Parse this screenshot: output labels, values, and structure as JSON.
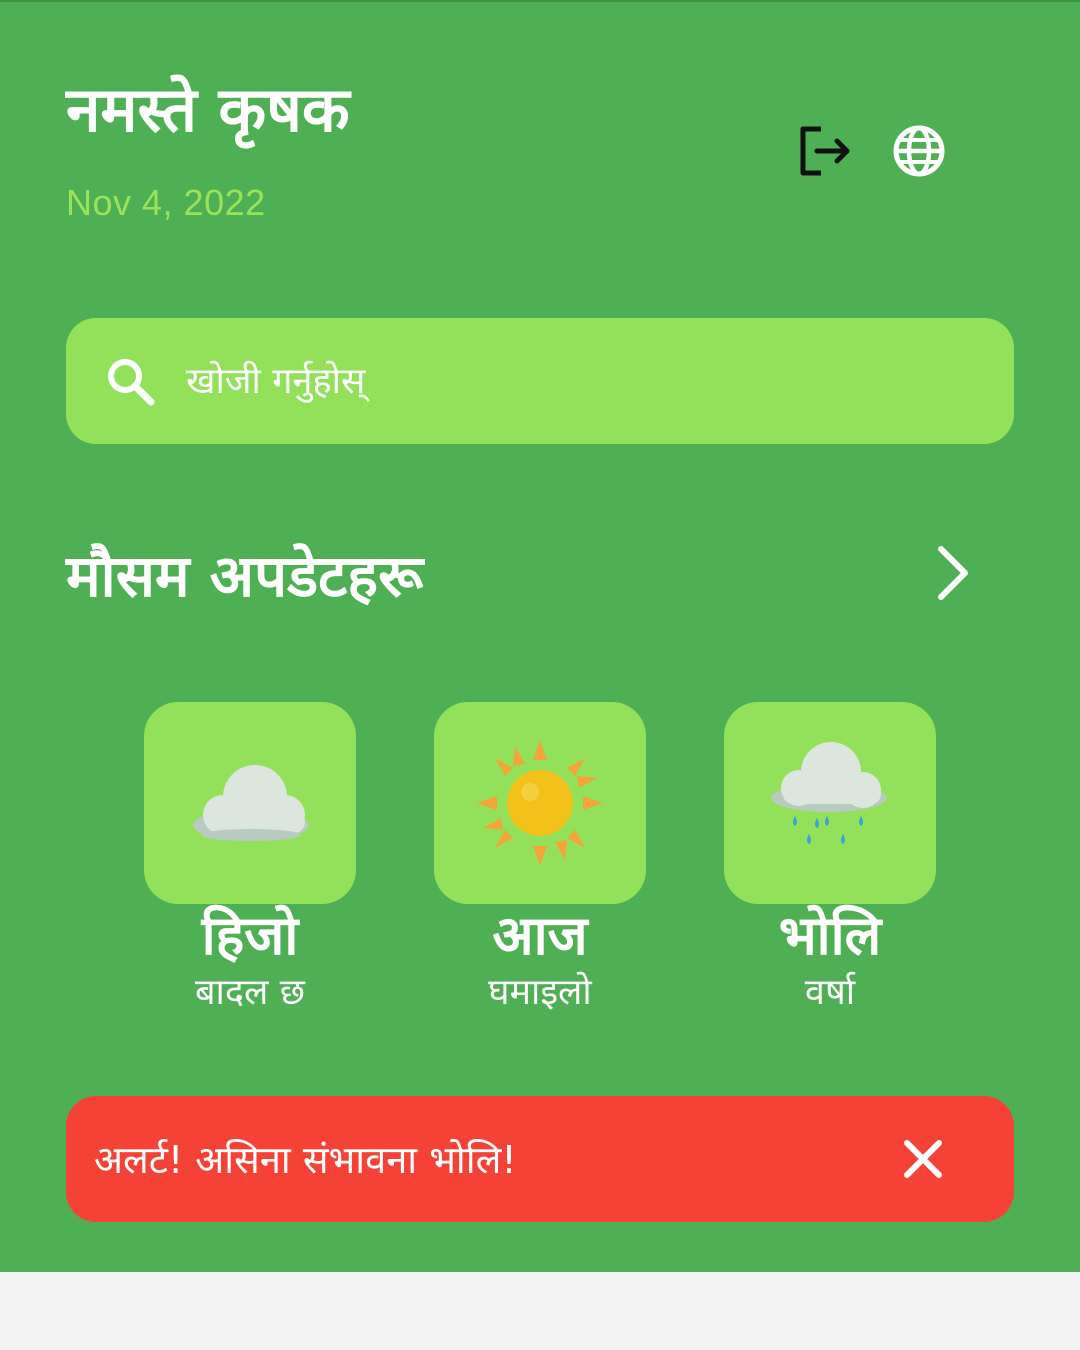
{
  "header": {
    "greeting": "नमस्ते कृषक",
    "date": "Nov 4, 2022",
    "logout_icon": "logout-icon",
    "language_icon": "globe-icon"
  },
  "search": {
    "placeholder": "खोजी गर्नुहोस्",
    "icon": "search-icon"
  },
  "weather_section": {
    "title": "मौसम अपडेटहरू",
    "arrow_icon": "chevron-right-icon",
    "days": [
      {
        "day": "हिजो",
        "condition": "बादल छ",
        "icon": "cloud-icon"
      },
      {
        "day": "आज",
        "condition": "घमाइलो",
        "icon": "sun-icon"
      },
      {
        "day": "भोलि",
        "condition": "वर्षा",
        "icon": "rain-cloud-icon"
      }
    ]
  },
  "alert": {
    "message": "अलर्ट! असिना संभावना भोलि!",
    "close_icon": "close-icon",
    "color": "#f44336"
  },
  "colors": {
    "background": "#4faf55",
    "accent": "#93e15a",
    "date_text": "#9be25a"
  }
}
